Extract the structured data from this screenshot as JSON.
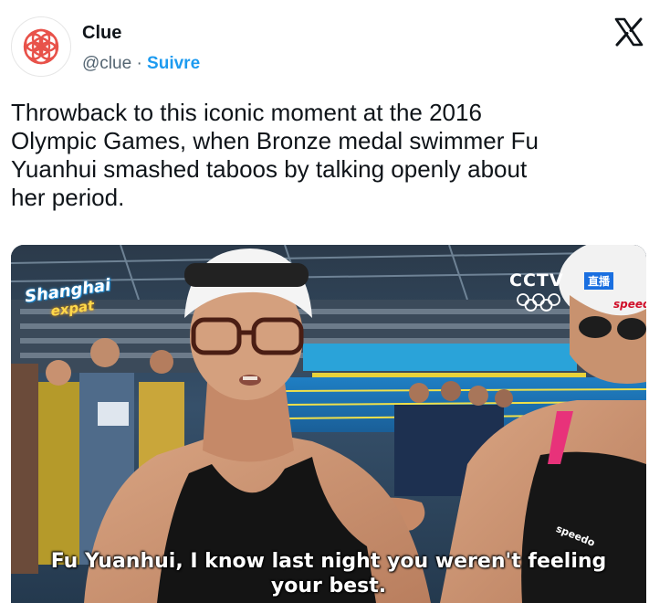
{
  "account": {
    "display_name": "Clue",
    "handle": "@clue",
    "separator": "·",
    "follow_label": "Suivre",
    "avatar_icon": "clue-flower-logo-icon",
    "brand_color": "#e8524a"
  },
  "platform": {
    "logo_icon": "x-logo-icon"
  },
  "tweet": {
    "text_line1": "Throwback to this iconic moment at the 2016",
    "text_line2": "Olympic Games, when Bronze medal swimmer Fu",
    "text_line3": "Yuanhui smashed taboos by talking openly about",
    "text_line4": "her period."
  },
  "media": {
    "watermark_left_1": "Shanghai",
    "watermark_left_2": "expat",
    "broadcaster": "CCTV",
    "live_badge": "直播",
    "cap_brand": "speed",
    "suit_brand": "speedo",
    "caption_line1": "Fu Yuanhui, I know last night you weren't feeling",
    "caption_line2": "your best."
  }
}
